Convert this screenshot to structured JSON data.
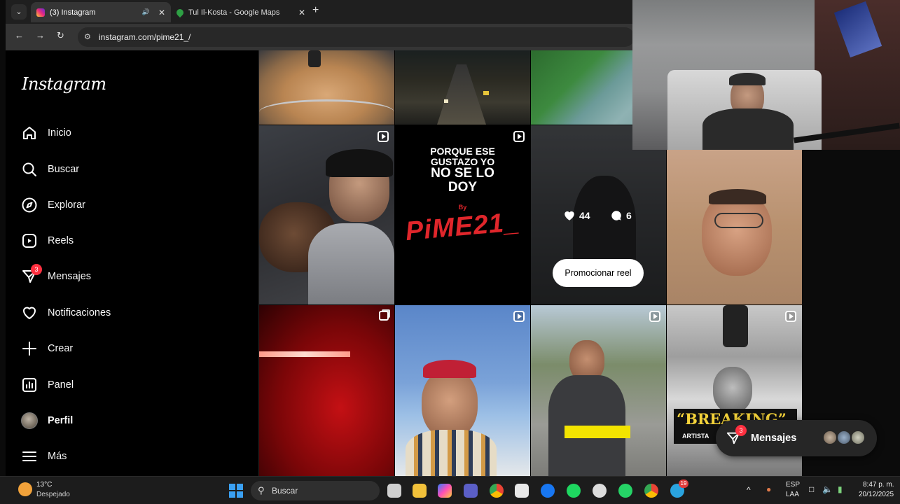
{
  "browser": {
    "tabs": [
      {
        "title": "(3) Instagram",
        "active": true
      },
      {
        "title": "Tul Il-Kosta - Google Maps",
        "active": false
      }
    ],
    "url": "instagram.com/pime21_/"
  },
  "sidebar": {
    "logo": "Instagram",
    "items": [
      {
        "label": "Inicio",
        "icon": "home-icon"
      },
      {
        "label": "Buscar",
        "icon": "search-icon"
      },
      {
        "label": "Explorar",
        "icon": "compass-icon"
      },
      {
        "label": "Reels",
        "icon": "reels-icon"
      },
      {
        "label": "Mensajes",
        "icon": "messenger-icon",
        "badge": "3"
      },
      {
        "label": "Notificaciones",
        "icon": "heart-icon"
      },
      {
        "label": "Crear",
        "icon": "plus-icon"
      },
      {
        "label": "Panel",
        "icon": "dashboard-icon"
      },
      {
        "label": "Perfil",
        "icon": "avatar"
      },
      {
        "label": "Más",
        "icon": "menu-icon"
      }
    ]
  },
  "grid": {
    "poster": {
      "line1": "PORQUE ESE",
      "line2": "GUSTAZO YO",
      "line3": "NO SE LO",
      "line4": "DOY",
      "by": "By",
      "brand": "PiME21_"
    },
    "hover": {
      "likes": "44",
      "comments": "6",
      "promote_label": "Promocionar reel"
    },
    "thumb_text": {
      "breaking": "“BREAKING”",
      "artista": "ARTISTA"
    }
  },
  "messages_pill": {
    "label": "Mensajes",
    "badge": "3"
  },
  "taskbar": {
    "weather_temp": "13°C",
    "weather_desc": "Despejado",
    "search_label": "Buscar",
    "lang_line1": "ESP",
    "lang_line2": "LAA",
    "time": "8:47 p. m.",
    "date": "20/12/2025",
    "notification_badge": "19"
  },
  "colors": {
    "badge": "#ff3040",
    "poster_brand": "#e0262b",
    "sidebar_bg": "#000000"
  }
}
